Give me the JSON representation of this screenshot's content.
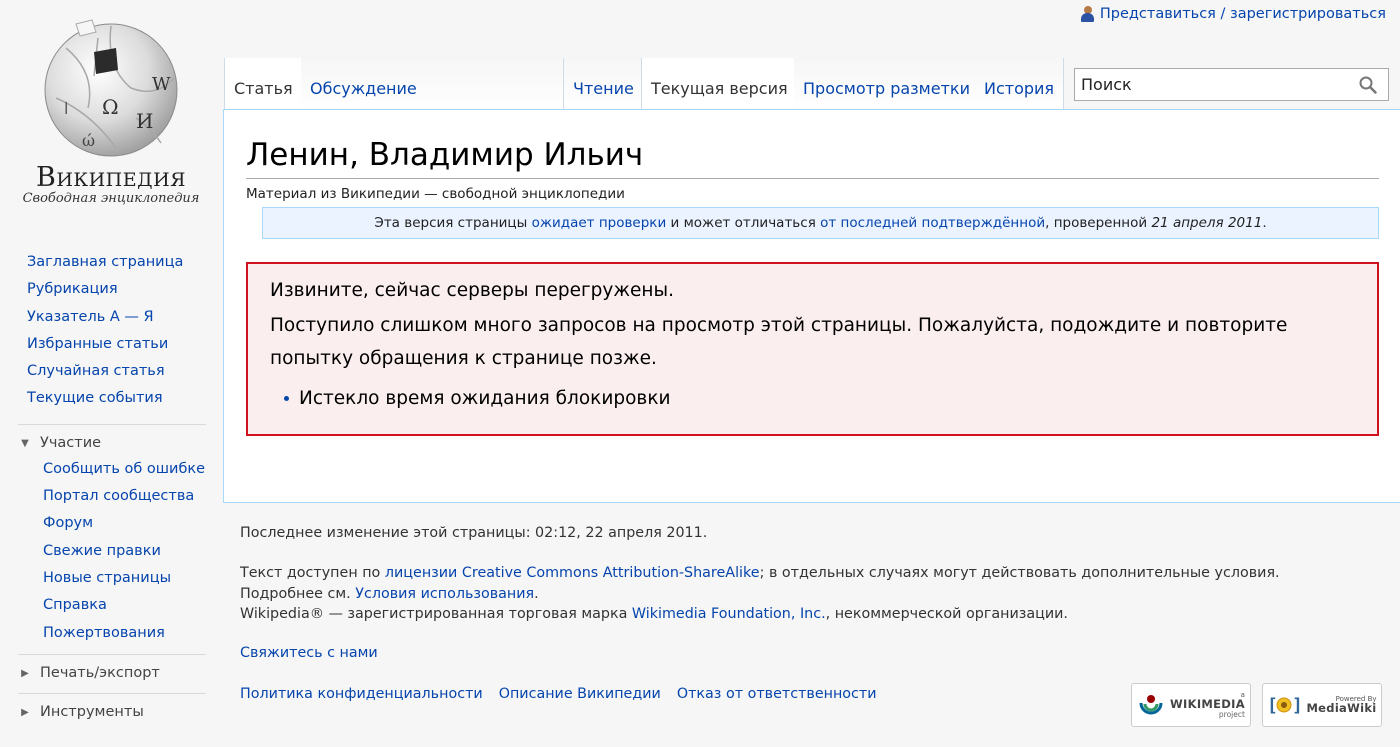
{
  "personal": {
    "login_label": "Представиться / зарегистрироваться"
  },
  "logo": {
    "wordmark": "Википедия",
    "tagline": "Свободная энциклопедия"
  },
  "sidebar": {
    "navigation": [
      {
        "label": "Заглавная страница"
      },
      {
        "label": "Рубрикация"
      },
      {
        "label": "Указатель А — Я"
      },
      {
        "label": "Избранные статьи"
      },
      {
        "label": "Случайная статья"
      },
      {
        "label": "Текущие события"
      }
    ],
    "participation": {
      "label": "Участие",
      "items": [
        {
          "label": "Сообщить об ошибке"
        },
        {
          "label": "Портал сообщества"
        },
        {
          "label": "Форум"
        },
        {
          "label": "Свежие правки"
        },
        {
          "label": "Новые страницы"
        },
        {
          "label": "Справка"
        },
        {
          "label": "Пожертвования"
        }
      ]
    },
    "print_export": {
      "label": "Печать/экспорт"
    },
    "tools": {
      "label": "Инструменты"
    }
  },
  "tabs": {
    "article": "Статья",
    "talk": "Обсуждение",
    "read": "Чтение",
    "current_version": "Текущая версия",
    "view_source": "Просмотр разметки",
    "history": "История"
  },
  "search": {
    "placeholder": "Поиск"
  },
  "article": {
    "title": "Ленин, Владимир Ильич",
    "site_sub": "Материал из Википедии — свободной энциклопедии",
    "flagged": {
      "part1": "Эта версия страницы ",
      "link1": "ожидает проверки",
      "part2": " и может отличаться ",
      "link2": "от последней подтверждённой",
      "part3": ", проверенной ",
      "date": "21 апреля 2011",
      "part4": "."
    },
    "error": {
      "title": "Извините, сейчас серверы перегружены.",
      "message": "Поступило слишком много запросов на просмотр этой страницы. Пожалуйста, подождите и повторите попытку обращения к странице позже.",
      "details": [
        "Истекло время ожидания блокировки"
      ]
    }
  },
  "footer": {
    "lastmod": "Последнее изменение этой страницы: 02:12, 22 апреля 2011.",
    "license_pre": "Текст доступен по ",
    "license_link": "лицензии Creative Commons Attribution-ShareAlike",
    "license_mid": "; в отдельных случаях могут действовать дополнительные условия. Подробнее см. ",
    "terms_link": "Условия использования",
    "license_end": ".",
    "trademark_pre": "Wikipedia® — зарегистрированная торговая марка ",
    "trademark_link": "Wikimedia Foundation, Inc.",
    "trademark_end": ", некоммерческой организации.",
    "contact": "Свяжитесь с нами",
    "places": [
      "Политика конфиденциальности",
      "Описание Википедии",
      "Отказ от ответственности"
    ],
    "wikimedia_badge": {
      "small": "a",
      "big": "WIKIMEDIA",
      "sub": "project"
    },
    "mediawiki_badge": {
      "small": "Powered By",
      "big": "MediaWiki"
    }
  }
}
